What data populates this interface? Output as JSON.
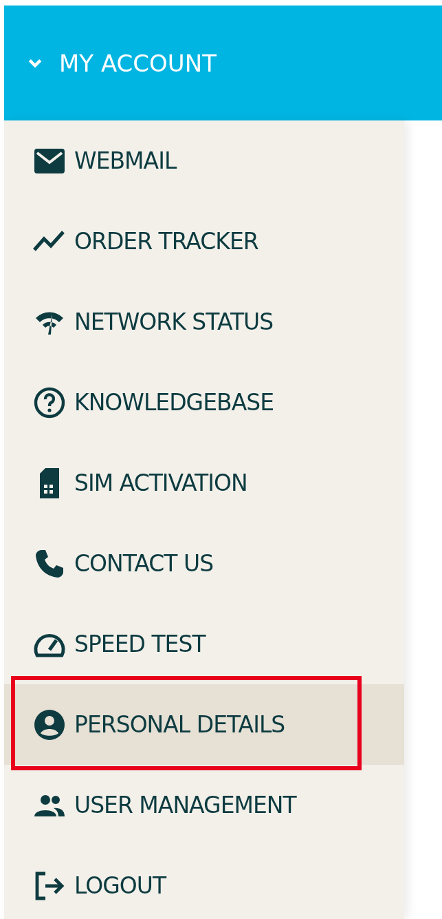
{
  "header": {
    "title": "MY ACCOUNT",
    "expanded": true
  },
  "menu": [
    {
      "label": "WEBMAIL",
      "selected": false,
      "highlighted": false
    },
    {
      "label": "ORDER TRACKER",
      "selected": false,
      "highlighted": false
    },
    {
      "label": "NETWORK STATUS",
      "selected": false,
      "highlighted": false
    },
    {
      "label": "KNOWLEDGEBASE",
      "selected": false,
      "highlighted": false
    },
    {
      "label": "SIM ACTIVATION",
      "selected": false,
      "highlighted": false
    },
    {
      "label": "CONTACT US",
      "selected": false,
      "highlighted": false
    },
    {
      "label": "SPEED TEST",
      "selected": false,
      "highlighted": false
    },
    {
      "label": "PERSONAL DETAILS",
      "selected": true,
      "highlighted": true
    },
    {
      "label": "USER MANAGEMENT",
      "selected": false,
      "highlighted": false
    },
    {
      "label": "LOGOUT",
      "selected": false,
      "highlighted": false
    }
  ]
}
